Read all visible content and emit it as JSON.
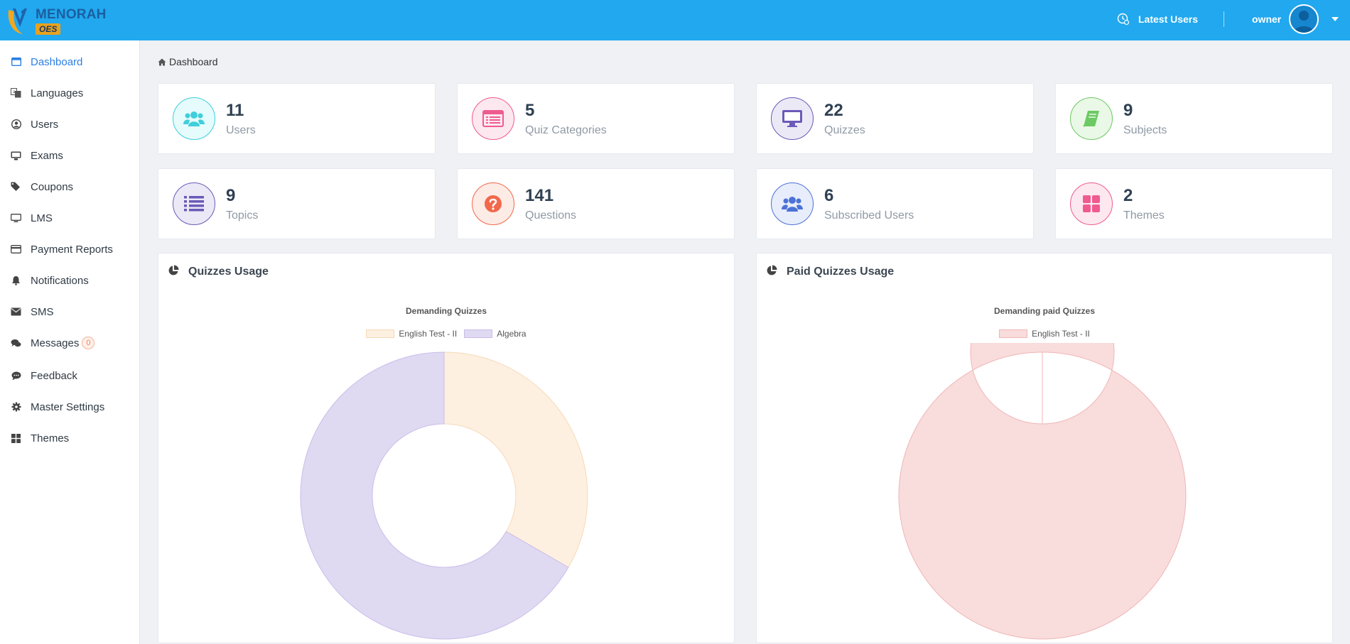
{
  "brand": {
    "name": "MENORAH",
    "sub": "OES"
  },
  "header": {
    "latest_users_label": "Latest Users",
    "user_name": "owner"
  },
  "sidebar": {
    "items": [
      {
        "label": "Dashboard",
        "icon": "dashboard-icon",
        "active": true
      },
      {
        "label": "Languages",
        "icon": "language-icon"
      },
      {
        "label": "Users",
        "icon": "user-circle-icon"
      },
      {
        "label": "Exams",
        "icon": "desktop-icon"
      },
      {
        "label": "Coupons",
        "icon": "tags-icon"
      },
      {
        "label": "LMS",
        "icon": "monitor-icon"
      },
      {
        "label": "Payment Reports",
        "icon": "credit-card-icon"
      },
      {
        "label": "Notifications",
        "icon": "bell-icon"
      },
      {
        "label": "SMS",
        "icon": "envelope-icon"
      },
      {
        "label": "Messages",
        "icon": "comments-icon",
        "badge": "0"
      },
      {
        "label": "Feedback",
        "icon": "comment-icon"
      },
      {
        "label": "Master Settings",
        "icon": "gear-icon"
      },
      {
        "label": "Themes",
        "icon": "grid-icon"
      }
    ]
  },
  "breadcrumb": {
    "label": "Dashboard"
  },
  "stats": [
    {
      "value": "11",
      "label": "Users",
      "icon": "users-icon",
      "color": "#3fcfdb",
      "bg": "#e6fbfc"
    },
    {
      "value": "5",
      "label": "Quiz Categories",
      "icon": "list-window-icon",
      "color": "#ef5b8f",
      "bg": "#fde8f0"
    },
    {
      "value": "22",
      "label": "Quizzes",
      "icon": "desktop-icon",
      "color": "#6b5ab7",
      "bg": "#ece9f7"
    },
    {
      "value": "9",
      "label": "Subjects",
      "icon": "book-icon",
      "color": "#6dc964",
      "bg": "#eaf8e7"
    },
    {
      "value": "9",
      "label": "Topics",
      "icon": "list-icon",
      "color": "#6b5ab7",
      "bg": "#ece9f7"
    },
    {
      "value": "141",
      "label": "Questions",
      "icon": "question-icon",
      "color": "#f1684b",
      "bg": "#fdebe6"
    },
    {
      "value": "6",
      "label": "Subscribed Users",
      "icon": "users-icon",
      "color": "#4d72d6",
      "bg": "#e7edfb"
    },
    {
      "value": "2",
      "label": "Themes",
      "icon": "grid-icon",
      "color": "#ef5b8f",
      "bg": "#fde8f0"
    }
  ],
  "panels": [
    {
      "title": "Quizzes Usage",
      "icon": "pie-chart-icon"
    },
    {
      "title": "Paid Quizzes Usage",
      "icon": "pie-chart-icon"
    }
  ],
  "chart_data": [
    {
      "type": "pie",
      "title": "Demanding Quizzes",
      "legend_position": "top",
      "categories": [
        "English Test - II",
        "Algebra"
      ],
      "values": [
        1,
        2
      ],
      "colors": [
        "#fdf0e0",
        "#e0d9f2"
      ],
      "border_colors": [
        "#f7d9b8",
        "#c9bdea"
      ]
    },
    {
      "type": "pie",
      "title": "Demanding paid Quizzes",
      "legend_position": "top",
      "categories": [
        "English Test - II"
      ],
      "values": [
        1
      ],
      "colors": [
        "#f9dcdc"
      ],
      "border_colors": [
        "#f0b6b6"
      ]
    }
  ]
}
